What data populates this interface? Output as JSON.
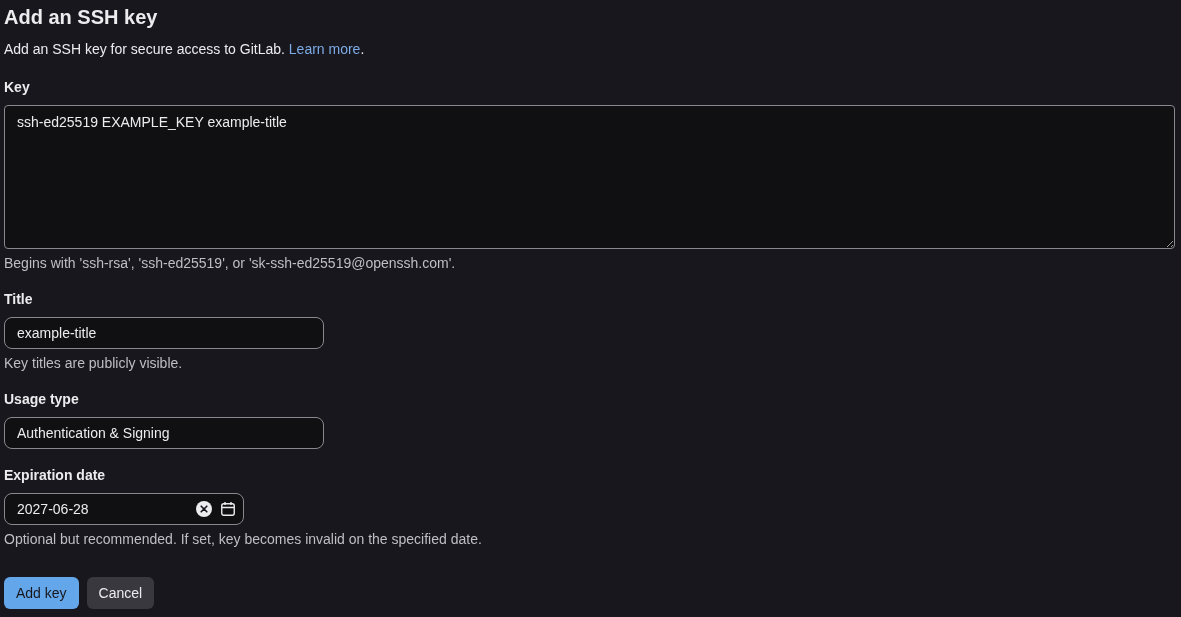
{
  "page": {
    "title": "Add an SSH key",
    "description": {
      "text": "Add an SSH key for secure access to GitLab.",
      "link": "Learn more",
      "after": "."
    }
  },
  "fields": [
    {
      "kind": "textarea",
      "label": "Key",
      "value": "ssh-ed25519 EXAMPLE_KEY example-title",
      "hint": "Begins with 'ssh-rsa', 'ssh-ed25519', or 'sk-ssh-ed25519@openssh.com'."
    },
    {
      "kind": "text",
      "label": "Title",
      "value": "example-title",
      "hint": "Key titles are publicly visible."
    },
    {
      "kind": "select",
      "label": "Usage type",
      "value": "Authentication & Signing"
    },
    {
      "kind": "date",
      "label": "Expiration date",
      "value": "2027-06-28",
      "hint": "Optional but recommended. If set, key becomes invalid on the specified date."
    }
  ],
  "buttons": [
    {
      "label": "Add key",
      "kind": "primary"
    },
    {
      "label": "Cancel",
      "kind": "secondary"
    }
  ]
}
